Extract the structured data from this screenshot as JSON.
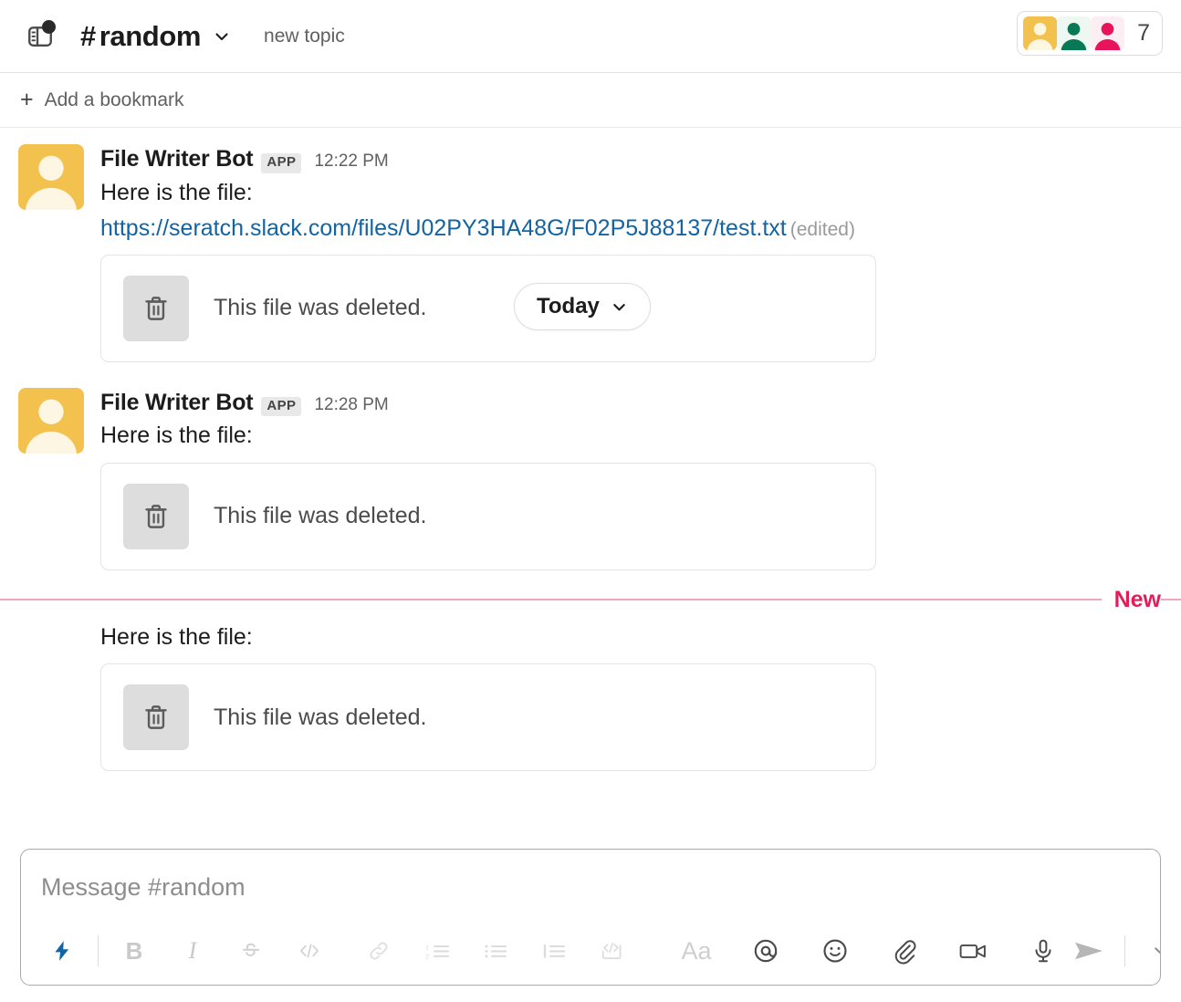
{
  "header": {
    "panel_toggle_name": "sidebar-toggle",
    "hash": "#",
    "channel_name": "random",
    "topic": "new topic",
    "member_count": "7"
  },
  "bookmarks": {
    "plus": "+",
    "add_label": "Add a bookmark"
  },
  "date_pill": {
    "label": "Today"
  },
  "messages": [
    {
      "author": "File Writer Bot",
      "badge": "APP",
      "time": "12:22 PM",
      "text": "Here is the file:",
      "link": "https://seratch.slack.com/files/U02PY3HA48G/F02P5J88137/test.txt",
      "edited": "(edited)",
      "file_card_text": "This file was deleted."
    },
    {
      "author": "File Writer Bot",
      "badge": "APP",
      "time": "12:28 PM",
      "text": "Here is the file:",
      "file_card_text": "This file was deleted."
    },
    {
      "text": "Here is the file:",
      "file_card_text": "This file was deleted."
    }
  ],
  "new_divider": {
    "label": "New",
    "line_color": "#eda8c0",
    "text_color": "#e01e5a"
  },
  "composer": {
    "placeholder": "Message #random",
    "value": "",
    "toolbar": [
      {
        "name": "shortcuts-lightning-icon",
        "label": ""
      },
      {
        "name": "bold-icon",
        "label": "B"
      },
      {
        "name": "italic-icon",
        "label": "I"
      },
      {
        "name": "strikethrough-icon",
        "label": "S"
      },
      {
        "name": "code-icon",
        "label": "</>"
      },
      {
        "name": "link-icon",
        "label": ""
      },
      {
        "name": "ordered-list-icon",
        "label": ""
      },
      {
        "name": "bulleted-list-icon",
        "label": ""
      },
      {
        "name": "blockquote-icon",
        "label": ""
      },
      {
        "name": "code-block-icon",
        "label": ""
      },
      {
        "name": "formatting-toggle-icon",
        "label": "Aa"
      },
      {
        "name": "mention-icon",
        "label": "@"
      },
      {
        "name": "emoji-icon",
        "label": ""
      },
      {
        "name": "attachment-icon",
        "label": ""
      },
      {
        "name": "video-clip-icon",
        "label": ""
      },
      {
        "name": "audio-clip-icon",
        "label": ""
      },
      {
        "name": "send-icon",
        "label": ""
      },
      {
        "name": "send-options-chevron-icon",
        "label": ""
      }
    ]
  },
  "colors": {
    "link": "#1264a3",
    "accent_blue": "#1264a3",
    "new_pink": "#e01e5a",
    "avatar_amber": "#f2c14e",
    "avatar_green": "#077a55",
    "avatar_pink": "#e8145b"
  }
}
